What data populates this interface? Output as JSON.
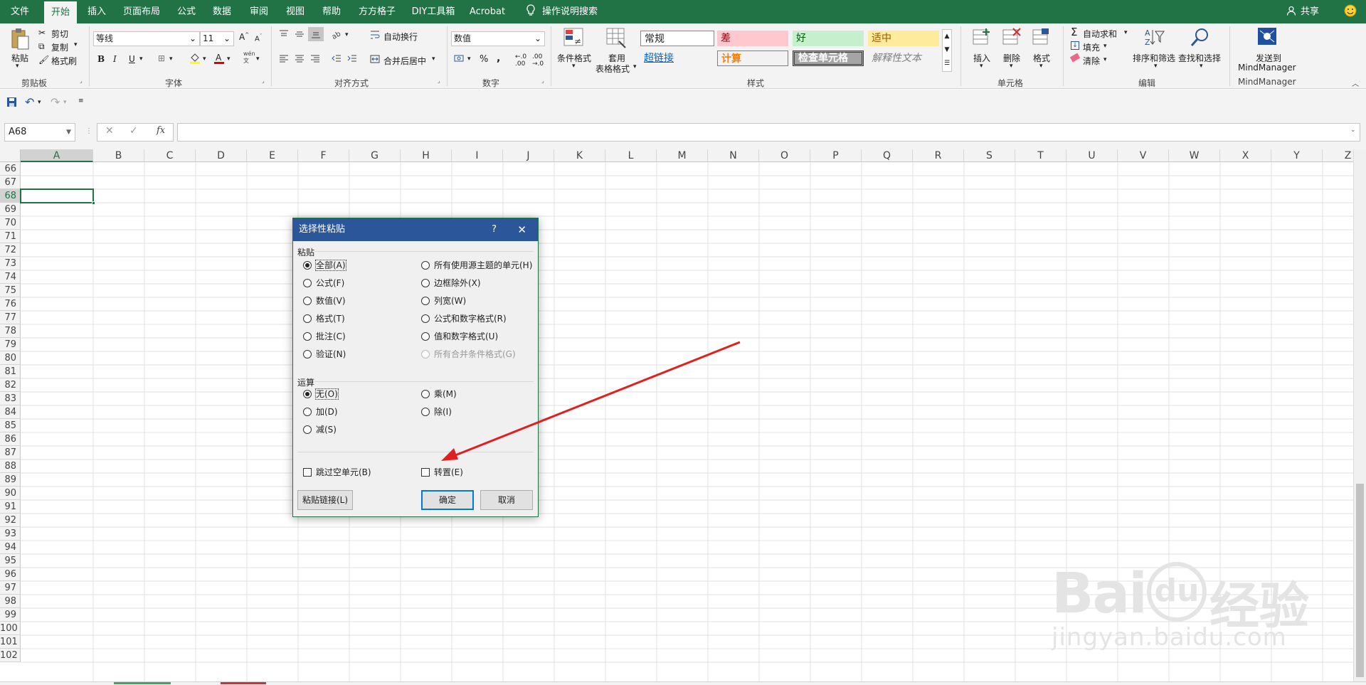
{
  "menu": {
    "items": [
      "文件",
      "开始",
      "插入",
      "页面布局",
      "公式",
      "数据",
      "审阅",
      "视图",
      "帮助",
      "方方格子",
      "DIY工具箱",
      "Acrobat",
      "操作说明搜索"
    ],
    "share": "共享"
  },
  "ribbon": {
    "clipboard": {
      "paste": "粘贴",
      "cut": "剪切",
      "copy": "复制",
      "painter": "格式刷",
      "label": "剪贴板"
    },
    "font": {
      "name": "等线",
      "size": "11",
      "label": "字体",
      "wen": "wén"
    },
    "align": {
      "wrap": "自动换行",
      "merge": "合并后居中",
      "label": "对齐方式"
    },
    "number": {
      "format": "数值",
      "label": "数字"
    },
    "styles": {
      "cond": "条件格式",
      "table1": "套用",
      "table2": "表格格式",
      "cells": [
        "常规",
        "差",
        "好",
        "适中",
        "超链接",
        "计算",
        "检查单元格",
        "解释性文本"
      ],
      "label": "样式"
    },
    "cells": {
      "insert": "插入",
      "delete": "删除",
      "format": "格式",
      "label": "单元格"
    },
    "editing": {
      "autosum": "自动求和",
      "fill": "填充",
      "clear": "清除",
      "sort": "排序和筛选",
      "find": "查找和选择",
      "label": "编辑"
    },
    "mind": {
      "send1": "发送到",
      "send2": "MindManager",
      "label": "MindManager"
    }
  },
  "namebox": "A68",
  "columns": [
    "A",
    "B",
    "C",
    "D",
    "E",
    "F",
    "G",
    "H",
    "I",
    "J",
    "K",
    "L",
    "M",
    "N",
    "O",
    "P",
    "Q",
    "R",
    "S",
    "T",
    "U",
    "V",
    "W",
    "X",
    "Y",
    "Z"
  ],
  "rows": [
    "66",
    "67",
    "68",
    "69",
    "70",
    "71",
    "72",
    "73",
    "74",
    "75",
    "76",
    "77",
    "78",
    "79",
    "80",
    "81",
    "82",
    "83",
    "84",
    "85",
    "86",
    "87",
    "88",
    "89",
    "90",
    "91",
    "92",
    "93",
    "94",
    "95",
    "96",
    "97",
    "98",
    "99",
    "100",
    "101",
    "102"
  ],
  "dialog": {
    "title": "选择性粘贴",
    "help": "?",
    "paste_label": "粘贴",
    "paste_left": [
      "全部(A)",
      "公式(F)",
      "数值(V)",
      "格式(T)",
      "批注(C)",
      "验证(N)"
    ],
    "paste_right": [
      "所有使用源主题的单元(H)",
      "边框除外(X)",
      "列宽(W)",
      "公式和数字格式(R)",
      "值和数字格式(U)",
      "所有合并条件格式(G)"
    ],
    "op_label": "运算",
    "op_left": [
      "无(O)",
      "加(D)",
      "减(S)"
    ],
    "op_right": [
      "乘(M)",
      "除(I)"
    ],
    "skip_blanks": "跳过空单元(B)",
    "transpose": "转置(E)",
    "paste_link": "粘贴链接(L)",
    "ok": "确定",
    "cancel": "取消"
  },
  "watermark": {
    "brand": "Bai",
    "du": "du",
    "cn": "经验",
    "url": "jingyan.baidu.com"
  },
  "colors": {
    "excel_green": "#217346",
    "dialog_blue": "#2b579a",
    "arrow_red": "#e02020"
  }
}
